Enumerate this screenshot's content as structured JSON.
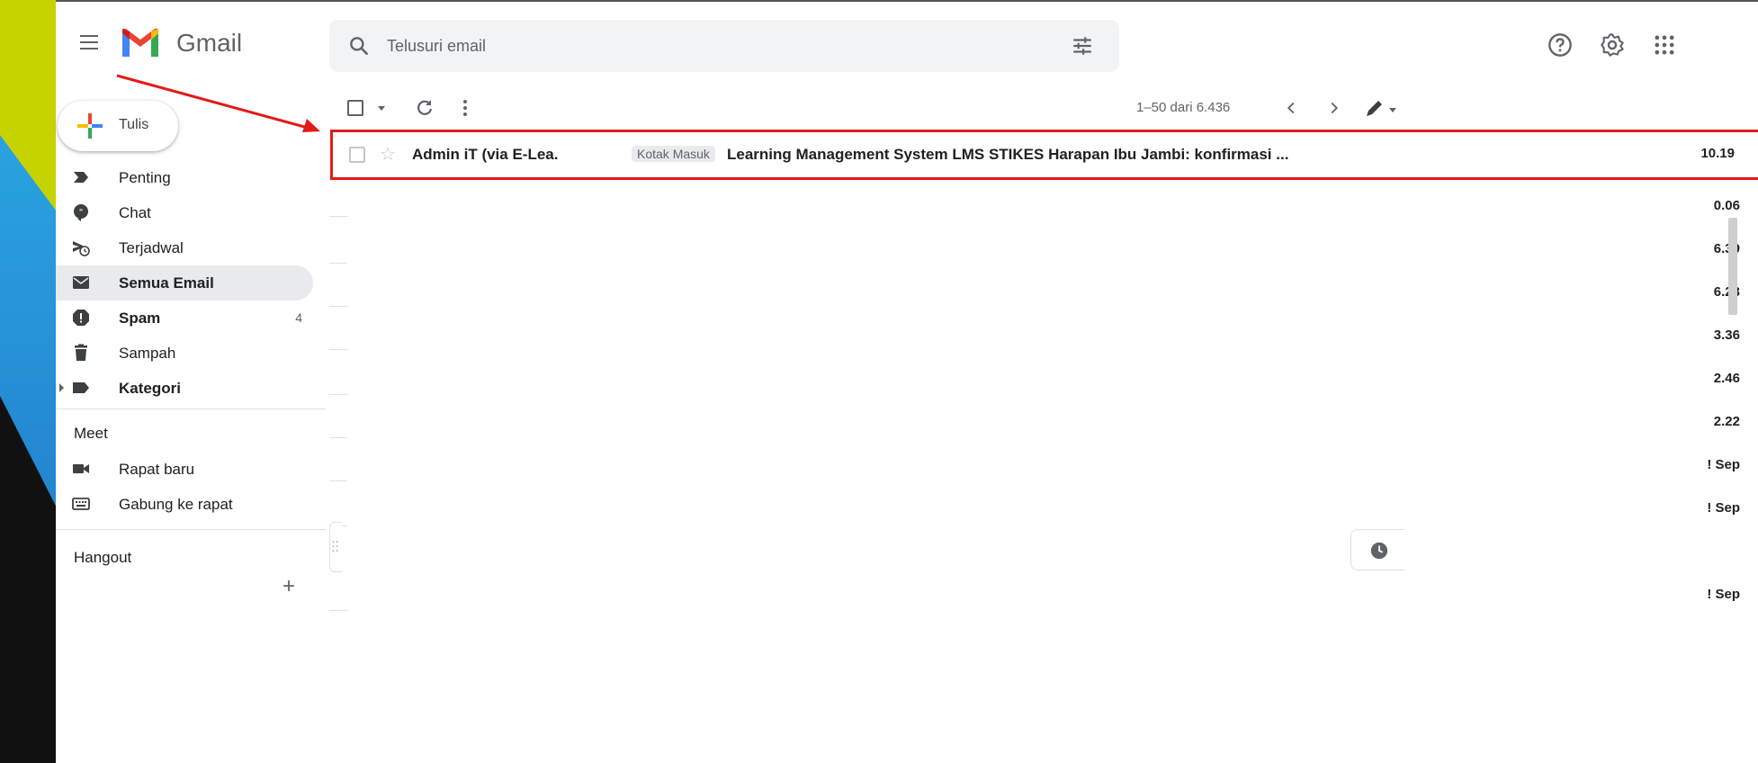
{
  "app": {
    "name": "Gmail"
  },
  "search": {
    "placeholder": "Telusuri email"
  },
  "sidebar": {
    "compose_label": "Tulis",
    "items": [
      {
        "label": "Penting",
        "icon": "label-important-icon"
      },
      {
        "label": "Chat",
        "icon": "chat-icon"
      },
      {
        "label": "Terjadwal",
        "icon": "scheduled-send-icon"
      },
      {
        "label": "Semua Email",
        "icon": "all-mail-icon",
        "active": true
      },
      {
        "label": "Spam",
        "icon": "spam-icon",
        "count": "4"
      },
      {
        "label": "Sampah",
        "icon": "trash-icon"
      },
      {
        "label": "Kategori",
        "icon": "label-icon"
      }
    ],
    "meet": {
      "title": "Meet",
      "items": [
        {
          "label": "Rapat baru",
          "icon": "video-camera-icon"
        },
        {
          "label": "Gabung ke rapat",
          "icon": "keyboard-icon"
        }
      ]
    },
    "hangout": {
      "title": "Hangout",
      "add_symbol": "+"
    }
  },
  "toolbar": {
    "pager": "1–50 dari 6.436"
  },
  "mail": {
    "sender": "Admin iT (via E-Lea.",
    "label": "Kotak Masuk",
    "subject": "Learning Management System LMS STIKES Harapan Ibu Jambi: konfirmasi ...",
    "time": "10.19"
  },
  "other_rows": [
    {
      "time": "0.06"
    },
    {
      "time": " 6.39"
    },
    {
      "time": " 6.23"
    },
    {
      "time": " 3.36"
    },
    {
      "time": " 2.46"
    },
    {
      "time": " 2.22"
    },
    {
      "time": "! Sep"
    },
    {
      "time": "! Sep"
    },
    {
      "time": ""
    },
    {
      "time": "! Sep"
    }
  ],
  "colors": {
    "highlight": "#e11b1b",
    "accent_yellow": "#c7d300",
    "accent_blue": "#1e6fc4"
  }
}
